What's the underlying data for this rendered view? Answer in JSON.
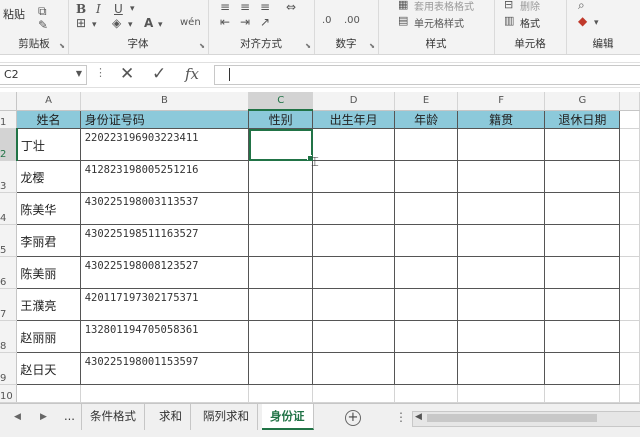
{
  "ribbon": {
    "groups": {
      "clipboard": "剪贴板",
      "font": "字体",
      "alignment": "对齐方式",
      "number": "数字",
      "styles": "样式",
      "cells": "单元格",
      "editing": "编辑"
    },
    "paste_label": "粘贴",
    "font_color_label": "A",
    "format_as_table": "套用表格格式",
    "cell_styles": "单元格样式",
    "format_label": "格式",
    "delete_label": "删除"
  },
  "formula_bar": {
    "name_box": "C2",
    "separator": "⋮",
    "formula": ""
  },
  "grid": {
    "columns": [
      "A",
      "B",
      "C",
      "D",
      "E",
      "F",
      "G"
    ],
    "selected_column": "C",
    "selected_row": "2",
    "active_cell": "C2",
    "rows": [
      {
        "num": "1",
        "cells": [
          "姓名",
          "身份证号码",
          "性别",
          "出生年月",
          "年龄",
          "籍贯",
          "退休日期"
        ]
      },
      {
        "num": "2",
        "cells": [
          "丁壮",
          "220223196903223411",
          "",
          "",
          "",
          "",
          ""
        ]
      },
      {
        "num": "3",
        "cells": [
          "龙樱",
          "412823198005251216",
          "",
          "",
          "",
          "",
          ""
        ]
      },
      {
        "num": "4",
        "cells": [
          "陈美华",
          "430225198003113537",
          "",
          "",
          "",
          "",
          ""
        ]
      },
      {
        "num": "5",
        "cells": [
          "李丽君",
          "430225198511163527",
          "",
          "",
          "",
          "",
          ""
        ]
      },
      {
        "num": "6",
        "cells": [
          "陈美丽",
          "430225198008123527",
          "",
          "",
          "",
          "",
          ""
        ]
      },
      {
        "num": "7",
        "cells": [
          "王濮亮",
          "420117197302175371",
          "",
          "",
          "",
          "",
          ""
        ]
      },
      {
        "num": "8",
        "cells": [
          "赵丽丽",
          "132801194705058361",
          "",
          "",
          "",
          "",
          ""
        ]
      },
      {
        "num": "9",
        "cells": [
          "赵日天",
          "430225198001153597",
          "",
          "",
          "",
          "",
          ""
        ]
      },
      {
        "num": "10",
        "cells": [
          "",
          "",
          "",
          "",
          "",
          "",
          ""
        ]
      }
    ]
  },
  "sheet_tabs": {
    "ellipsis": "...",
    "tabs": [
      "条件格式",
      "求和",
      "隔列求和",
      "身份证"
    ],
    "active": "身份证",
    "add_label": "+"
  },
  "colors": {
    "header_fill": "#8cc9da",
    "accent": "#217346"
  }
}
